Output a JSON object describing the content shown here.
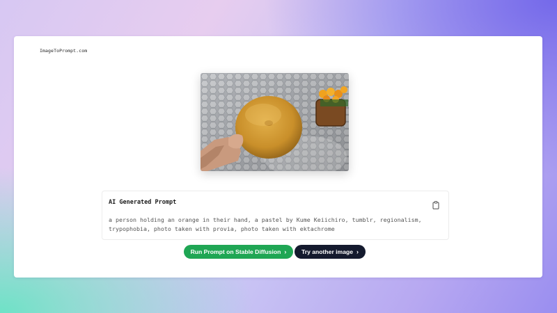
{
  "header": {
    "brand": "ImageToPrompt.com"
  },
  "image": {
    "description_icon": "uploaded-photo"
  },
  "prompt": {
    "title": "AI Generated Prompt",
    "text": "a person holding an orange in their hand, a pastel by Kume Keiichiro, tumblr, regionalism, trypophobia, photo taken with provia, photo taken with ektachrome",
    "copy_icon": "clipboard-icon"
  },
  "actions": {
    "run_label": "Run Prompt on Stable Diffusion",
    "try_label": "Try another image",
    "chevron": "›"
  },
  "colors": {
    "primary_green": "#1fa654",
    "dark_button": "#141a2e",
    "card": "#ffffff"
  }
}
